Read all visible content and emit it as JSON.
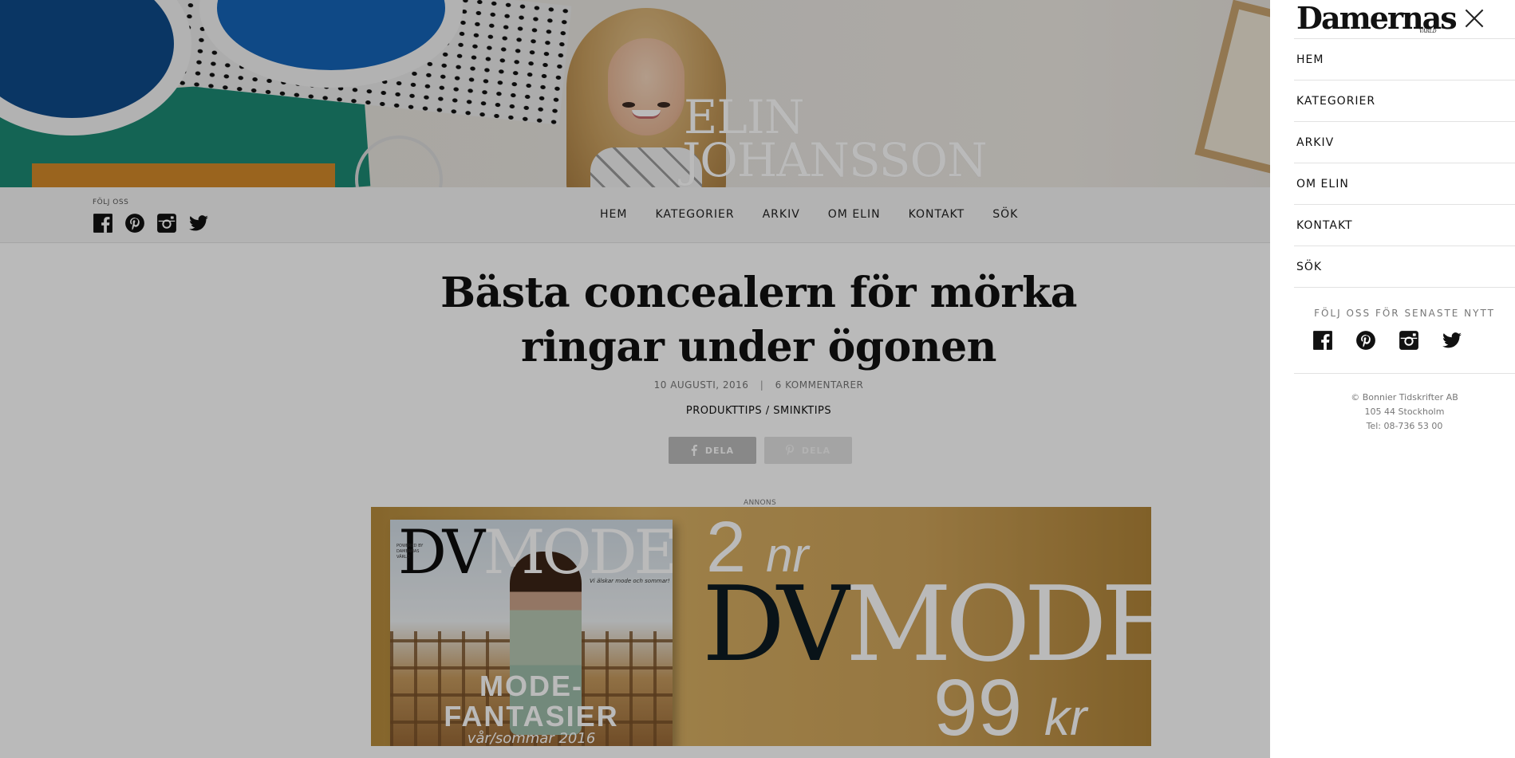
{
  "hero": {
    "name_line1": "ELIN",
    "name_line2": "JOHANSSON"
  },
  "header": {
    "follow_label": "FÖLJ OSS",
    "social_icons": [
      "facebook-icon",
      "pinterest-icon",
      "instagram-icon",
      "twitter-icon"
    ],
    "nav": [
      "HEM",
      "KATEGORIER",
      "ARKIV",
      "OM ELIN",
      "KONTAKT",
      "SÖK"
    ]
  },
  "article": {
    "title_line1": "Bästa concealern för mörka",
    "title_line2": "ringar under ögonen",
    "date": "10 AUGUSTI, 2016",
    "separator": "|",
    "comments": "6 KOMMENTARER",
    "categories": "PRODUKTTIPS / SMINKTIPS",
    "share_fb_label": "DELA",
    "share_pin_label": "DELA"
  },
  "ad": {
    "label": "ANNONS",
    "cover_logo_dv": "DV",
    "cover_logo_mode": "MODE",
    "cover_small": "POWERED BY DAMERNAS VÄRLD",
    "cover_sub": "Vi älskar mode och sommar!",
    "cover_headline_1": "MODE-",
    "cover_headline_2": "FANTASIER",
    "cover_season": "vår/sommar 2016",
    "nr_number": "2",
    "nr_suffix": "nr",
    "big_dv": "DV",
    "big_mode": "MODE",
    "price_number": "99",
    "price_suffix": "kr"
  },
  "side_panel": {
    "brand": "Damernas",
    "brand_sub": "VÄRLD",
    "items": [
      "HEM",
      "KATEGORIER",
      "ARKIV",
      "OM ELIN",
      "KONTAKT",
      "SÖK"
    ],
    "follow_text": "FÖLJ OSS FÖR SENASTE NYTT",
    "social_icons": [
      "facebook-icon",
      "pinterest-icon",
      "instagram-icon",
      "twitter-icon"
    ],
    "footer": [
      "© Bonnier Tidskrifter AB",
      "105 44 Stockholm",
      "Tel: 08-736 53 00"
    ]
  },
  "colors": {
    "overlay": "#000000",
    "ad_gold": "#cfa45a",
    "text_dark": "#111111"
  }
}
